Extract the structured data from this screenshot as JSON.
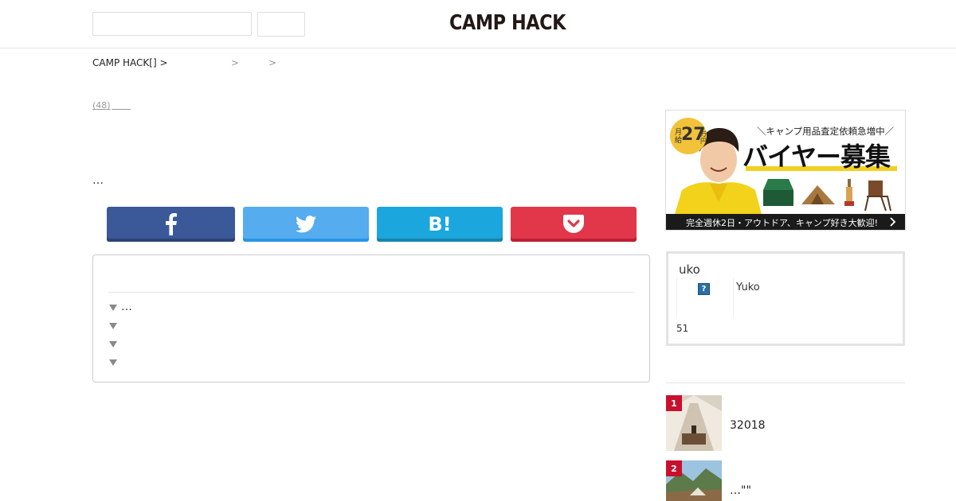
{
  "header": {
    "logo": "CAMP HACK",
    "search_placeholder": "",
    "search_button_label": ""
  },
  "breadcrumb": {
    "home": "CAMP HACK[] >",
    "sep1": ">",
    "sep2": ">"
  },
  "article": {
    "count_link": "(48)",
    "lead_ellipsis": "…"
  },
  "share": {
    "facebook_icon": "facebook-icon",
    "twitter_icon": "twitter-icon",
    "hatena_label": "B!",
    "pocket_icon": "pocket-icon",
    "colors": {
      "facebook": "#3b5998",
      "twitter": "#55acee",
      "hatena": "#1ba6dd",
      "pocket": "#e2364a"
    }
  },
  "toc": {
    "items": [
      {
        "text": "…"
      },
      {
        "text": ""
      },
      {
        "text": ""
      },
      {
        "text": ""
      }
    ]
  },
  "ad": {
    "badge_month": "月給",
    "badge_amount": "27",
    "badge_unit": "万円",
    "headline_small": "＼キャンプ用品査定依頼急増中／",
    "headline_big": "バイヤー募集",
    "footer": "完全週休2日・アウトドア、キャンプ好き大歓迎!"
  },
  "author": {
    "name_top": "uko",
    "avatar_glyph": "?",
    "name": "Yuko",
    "count": "51"
  },
  "ranking": [
    {
      "rank": "1",
      "title": "32018"
    },
    {
      "rank": "2",
      "title": "…\"\""
    }
  ]
}
